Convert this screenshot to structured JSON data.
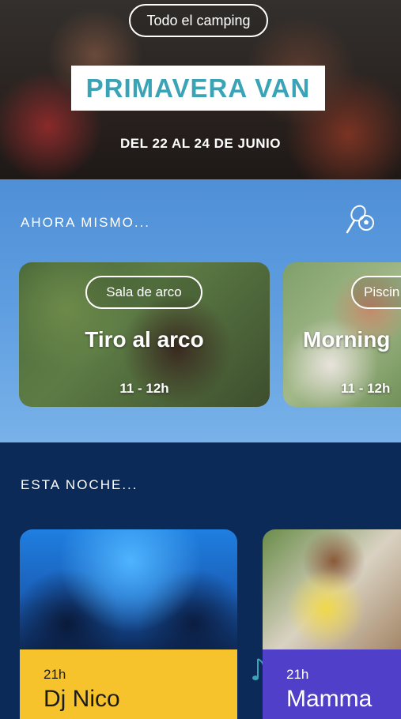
{
  "hero": {
    "chip_label": "Todo el camping",
    "event_name": "PRIMAVERA VAN",
    "dates": "DEL 22 AL 24 DE JUNIO"
  },
  "now": {
    "title": "AHORA MISMO...",
    "icon": "sports-icon",
    "activities": [
      {
        "chip": "Sala de arco",
        "title": "Tiro al arco",
        "time": "11 - 12h"
      },
      {
        "chip": "Piscin",
        "title": "Morning",
        "time": "11 - 12h"
      }
    ]
  },
  "tonight": {
    "title": "ESTA NOCHE...",
    "events": [
      {
        "time": "21h",
        "title": "Dj Nico",
        "color": "#f6c32c"
      },
      {
        "time": "21h",
        "title": "Mamma",
        "color": "#4f3fc9"
      }
    ]
  },
  "colors": {
    "accent_teal": "#3aa3b5",
    "now_background": "#5f9ee0",
    "tonight_background": "#0b2a57"
  }
}
